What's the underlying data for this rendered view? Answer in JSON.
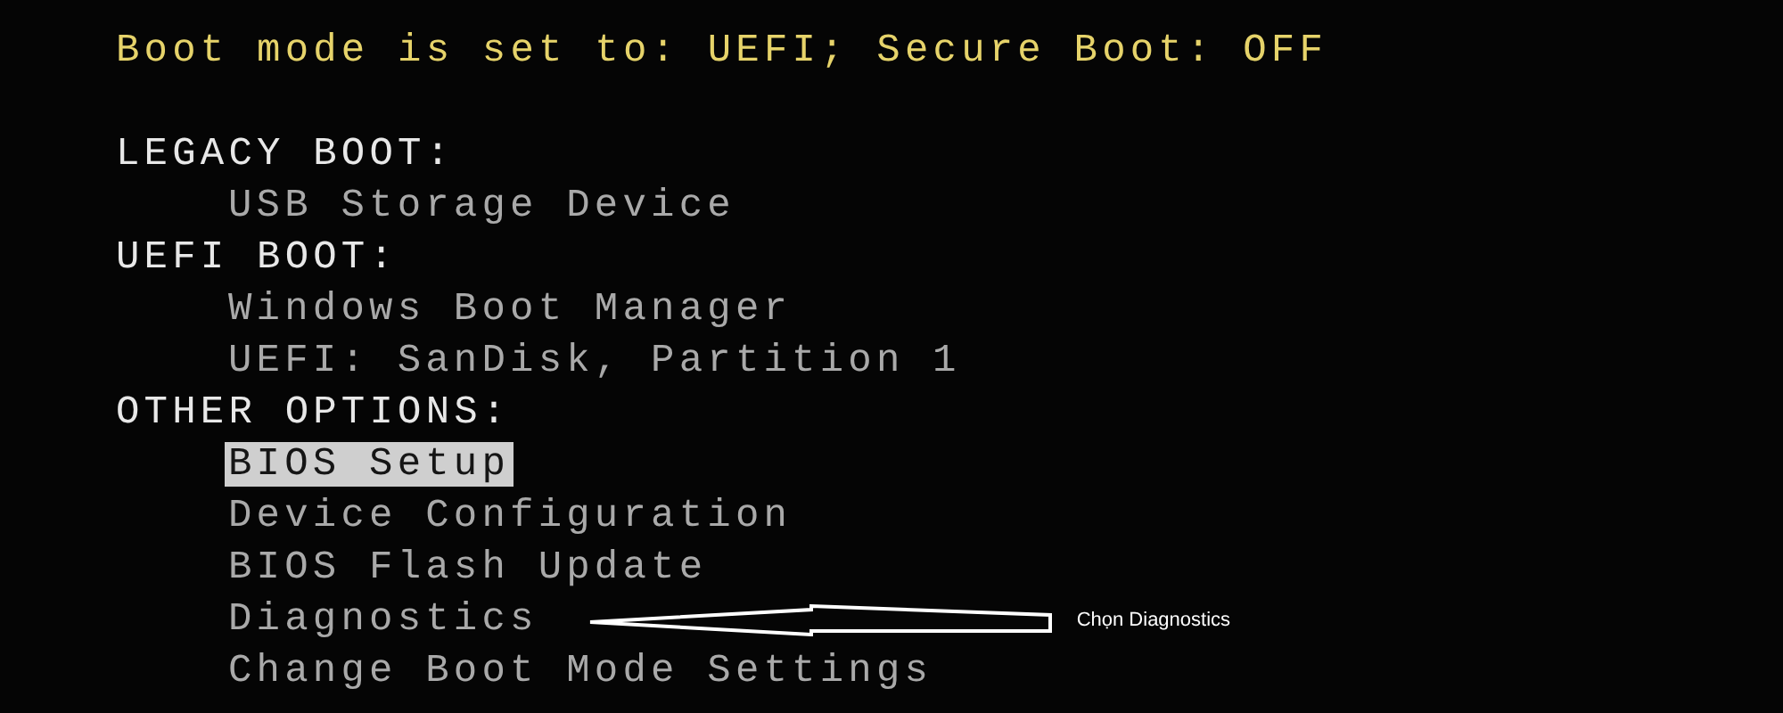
{
  "status_line": "Boot mode is set to: UEFI; Secure Boot: OFF",
  "sections": [
    {
      "title": "LEGACY BOOT:",
      "items": [
        {
          "label": "USB Storage Device",
          "selected": false
        }
      ]
    },
    {
      "title": "UEFI BOOT:",
      "items": [
        {
          "label": "Windows Boot Manager",
          "selected": false
        },
        {
          "label": "UEFI: SanDisk, Partition 1",
          "selected": false
        }
      ]
    },
    {
      "title": "OTHER OPTIONS:",
      "items": [
        {
          "label": "BIOS Setup",
          "selected": true
        },
        {
          "label": "Device Configuration",
          "selected": false
        },
        {
          "label": "BIOS Flash Update",
          "selected": false
        },
        {
          "label": "Diagnostics",
          "selected": false,
          "annotation": "Chọn Diagnostics"
        },
        {
          "label": "Change Boot Mode Settings",
          "selected": false
        }
      ]
    }
  ]
}
